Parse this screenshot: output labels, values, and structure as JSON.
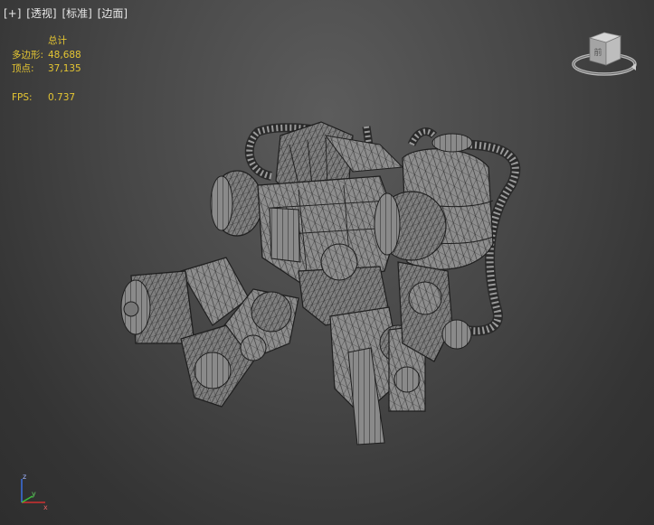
{
  "viewport": {
    "labels": [
      "[+]",
      "[透视]",
      "[标准]",
      "[边面]"
    ]
  },
  "statistics": {
    "header": "总计",
    "polygons_label": "多边形:",
    "polygons_value": "48,688",
    "vertices_label": "顶点:",
    "vertices_value": "37,135",
    "fps_label": "FPS:",
    "fps_value": "0.737"
  },
  "viewcube": {
    "face_label": "前"
  },
  "axis_tripod": {
    "z_label": "z",
    "x_label": "x",
    "y_label": "y",
    "colors": {
      "x": "#d03030",
      "y": "#3ac03a",
      "z": "#3a6fe0"
    }
  },
  "model": {
    "name": "wireframe-mech-robot",
    "colors": {
      "fill": "#8c8c8c",
      "wire": "#2a2a2a",
      "shadow": "#6e6e6e"
    }
  }
}
